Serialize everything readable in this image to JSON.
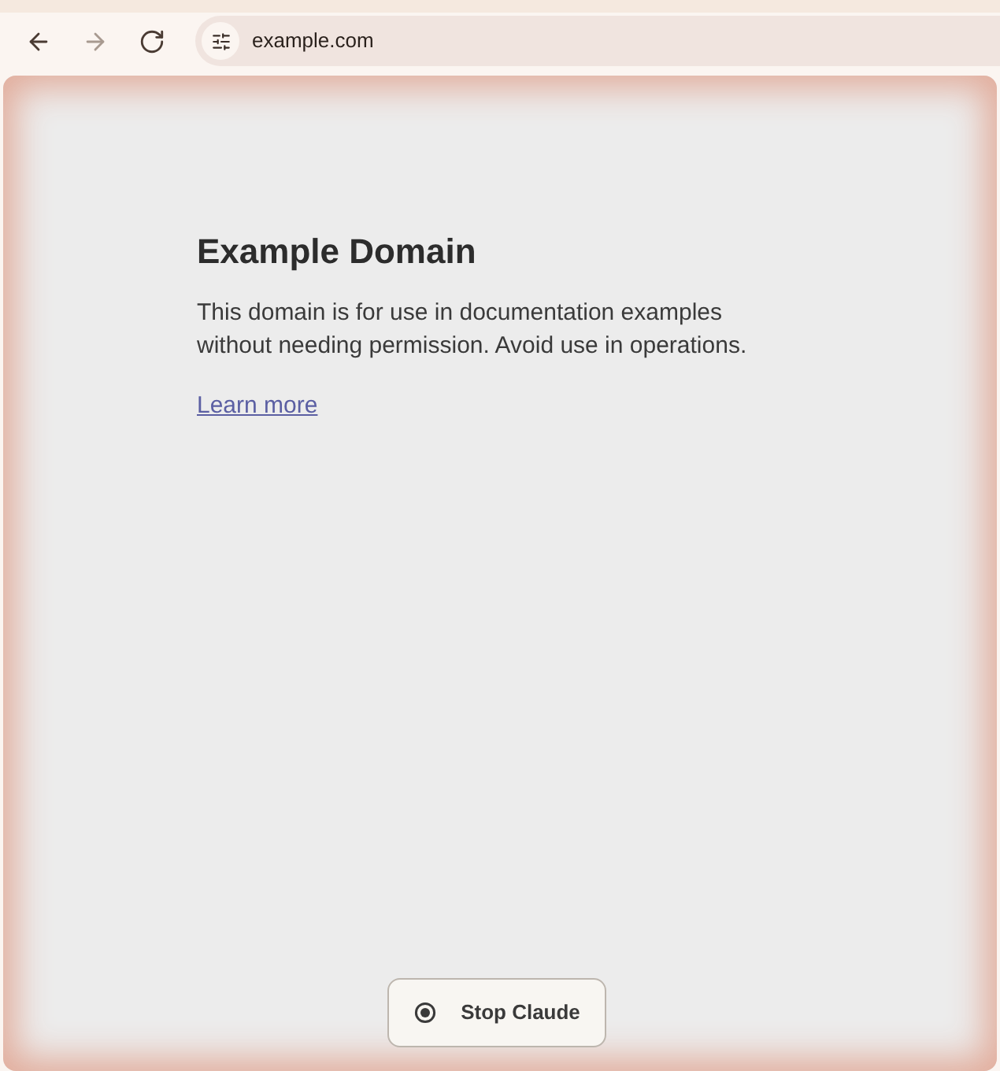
{
  "toolbar": {
    "nav_buttons": [
      {
        "kind": "back",
        "disabled": false
      },
      {
        "kind": "forward",
        "disabled": true
      },
      {
        "kind": "reload",
        "disabled": false
      }
    ],
    "address": "example.com"
  },
  "page": {
    "heading": "Example Domain",
    "paragraph": "This domain is for use in documentation examples without needing permission. Avoid use in operations.",
    "link": "Learn more"
  },
  "stop_button": {
    "label": "Stop Claude"
  }
}
